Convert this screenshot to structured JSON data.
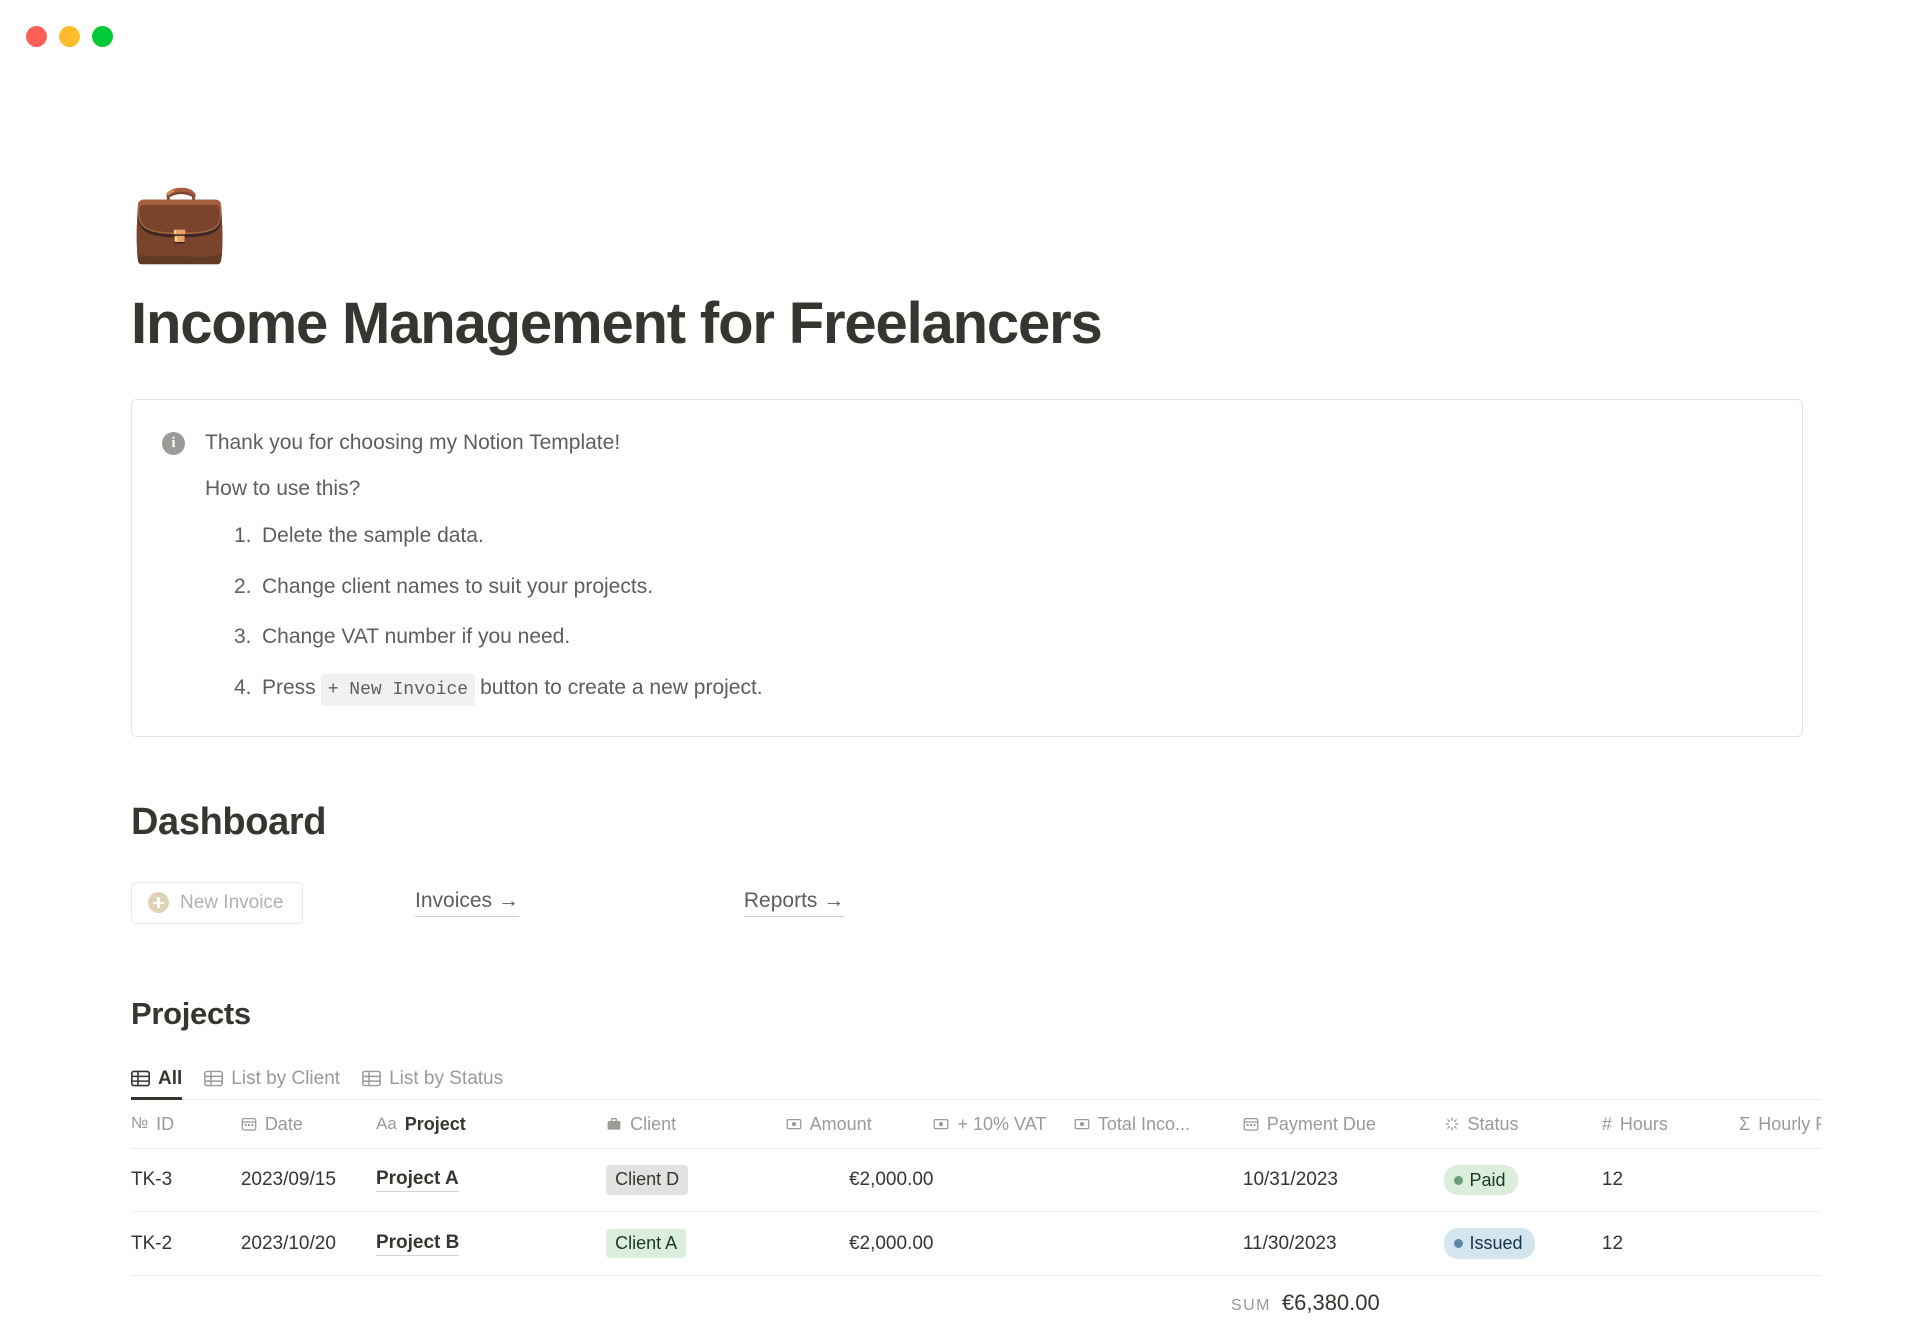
{
  "window": {
    "traffic_lights": [
      {
        "name": "close",
        "color": "#ff5f57"
      },
      {
        "name": "minimize",
        "color": "#ffbd2e"
      },
      {
        "name": "maximize",
        "color": "#00ca35"
      }
    ]
  },
  "page": {
    "emoji": "💼",
    "title": "Income Management for Freelancers"
  },
  "callout": {
    "icon": "info-icon",
    "heading": "Thank you for choosing my Notion Template!",
    "subheading": "How to use this?",
    "steps": [
      {
        "num": "1.",
        "before": "Delete the sample data.",
        "code": "",
        "after": ""
      },
      {
        "num": "2.",
        "before": "Change client names to suit your projects.",
        "code": "",
        "after": ""
      },
      {
        "num": "3.",
        "before": "Change VAT number if you need.",
        "code": "",
        "after": ""
      },
      {
        "num": "4.",
        "before": "Press",
        "code": "+ New Invoice",
        "after": "button to create a new project."
      }
    ]
  },
  "dashboard": {
    "heading": "Dashboard",
    "new_invoice_label": "New Invoice",
    "links": [
      {
        "label": "Invoices →"
      },
      {
        "label": "Reports →"
      }
    ]
  },
  "projects": {
    "heading": "Projects",
    "tabs": [
      {
        "label": "All",
        "active": true
      },
      {
        "label": "List by Client",
        "active": false
      },
      {
        "label": "List by Status",
        "active": false
      }
    ],
    "columns": [
      {
        "icon": "number-icon",
        "label": "ID"
      },
      {
        "icon": "calendar-icon",
        "label": "Date"
      },
      {
        "icon": "text-icon",
        "label": "Project"
      },
      {
        "icon": "briefcase-icon",
        "label": "Client"
      },
      {
        "icon": "money-icon",
        "label": "Amount"
      },
      {
        "icon": "money-icon",
        "label": "+ 10% VAT"
      },
      {
        "icon": "money-icon",
        "label": "Total Inco..."
      },
      {
        "icon": "calendar-icon",
        "label": "Payment Due"
      },
      {
        "icon": "status-icon",
        "label": "Status"
      },
      {
        "icon": "hash-icon",
        "label": "Hours"
      },
      {
        "icon": "sigma-icon",
        "label": "Hourly Rate"
      }
    ],
    "rows": [
      {
        "id": "TK-3",
        "date": "2023/09/15",
        "project": "Project A",
        "client": "Client D",
        "client_color": "gray",
        "amount": "€2,000.00",
        "vat": "",
        "total_income": "",
        "payment_due": "10/31/2023",
        "status": "Paid",
        "status_color": "green",
        "hours": "12",
        "hourly_rate": ""
      },
      {
        "id": "TK-2",
        "date": "2023/10/20",
        "project": "Project B",
        "client": "Client A",
        "client_color": "green",
        "amount": "€2,000.00",
        "vat": "",
        "total_income": "",
        "payment_due": "11/30/2023",
        "status": "Issued",
        "status_color": "blue",
        "hours": "12",
        "hourly_rate": ""
      }
    ],
    "sum": {
      "label": "SUM",
      "value": "€6,380.00"
    }
  }
}
